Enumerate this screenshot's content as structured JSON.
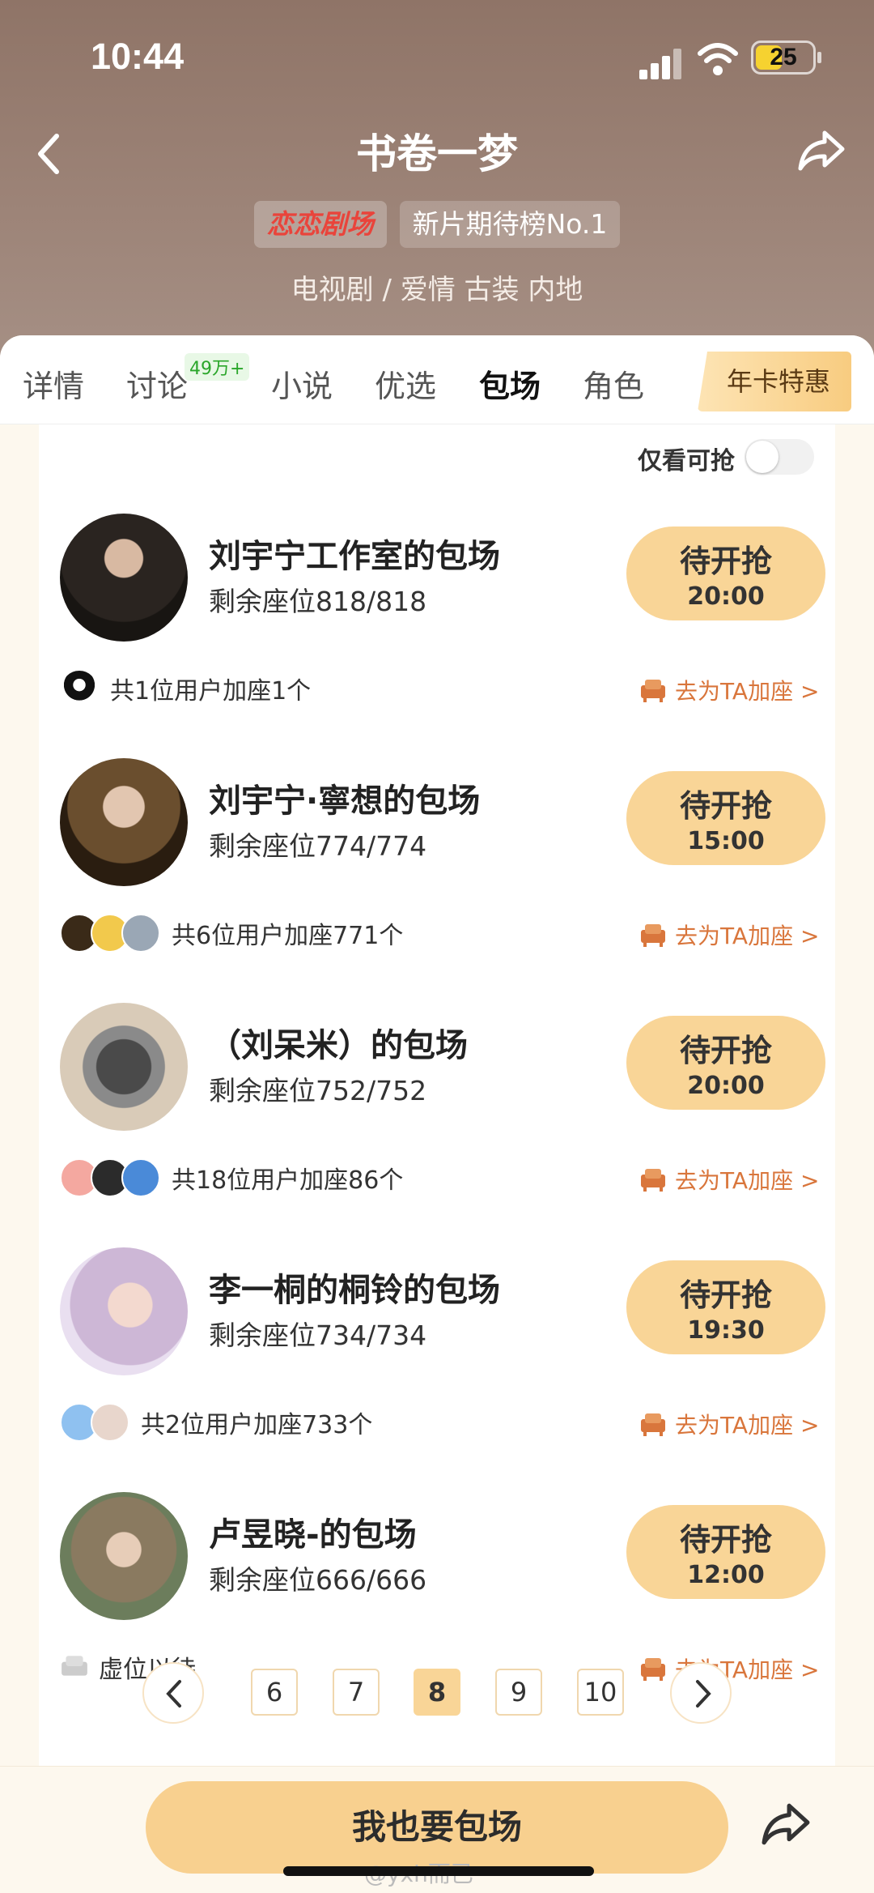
{
  "status_bar": {
    "time": "10:44",
    "battery": "25"
  },
  "header": {
    "title": "书卷一梦",
    "brand_tag": "恋恋剧场",
    "rank_tag": "新片期待榜No.1",
    "genre": "电视剧 / 爱情 古装 内地"
  },
  "tabs": [
    {
      "label": "详情"
    },
    {
      "label": "讨论",
      "badge": "49万+"
    },
    {
      "label": "小说"
    },
    {
      "label": "优选"
    },
    {
      "label": "包场",
      "active": true
    },
    {
      "label": "角色"
    }
  ],
  "vip_tab": "年卡特惠",
  "filter": {
    "label": "仅看可抢",
    "on": false
  },
  "items": [
    {
      "name": "刘宇宁工作室的包场",
      "seats": "剩余座位818/818",
      "status": "待开抢",
      "time": "20:00",
      "users": "共1位用户加座1个",
      "action": "去为TA加座 >"
    },
    {
      "name": "刘宇宁·寧想的包场",
      "seats": "剩余座位774/774",
      "status": "待开抢",
      "time": "15:00",
      "users": "共6位用户加座771个",
      "action": "去为TA加座 >"
    },
    {
      "name": "（刘呆米）的包场",
      "seats": "剩余座位752/752",
      "status": "待开抢",
      "time": "20:00",
      "users": "共18位用户加座86个",
      "action": "去为TA加座 >"
    },
    {
      "name": "李一桐的桐铃的包场",
      "seats": "剩余座位734/734",
      "status": "待开抢",
      "time": "19:30",
      "users": "共2位用户加座733个",
      "action": "去为TA加座 >"
    },
    {
      "name": "卢昱晓-的包场",
      "seats": "剩余座位666/666",
      "status": "待开抢",
      "time": "12:00",
      "users": "虚位以待",
      "action": "去为TA加座 >"
    }
  ],
  "pagination": {
    "pages": [
      "6",
      "7",
      "8",
      "9",
      "10"
    ],
    "current": "8"
  },
  "cta": "我也要包场",
  "watermark": "@yxh而已",
  "colors": {
    "accent": "#f9d597",
    "action": "#d9763c",
    "brand": "#e9443b"
  }
}
